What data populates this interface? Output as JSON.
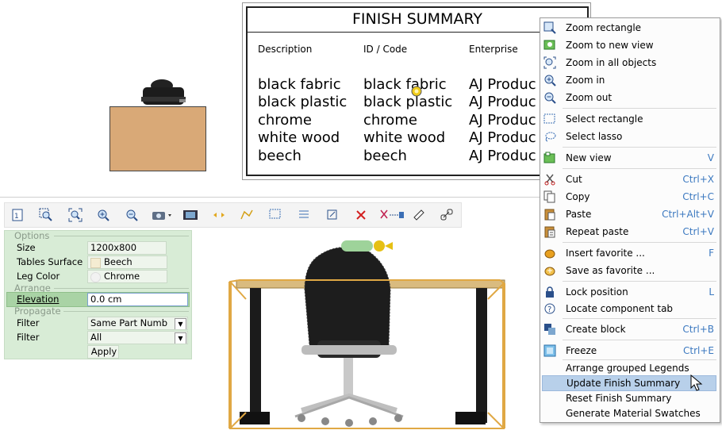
{
  "finish_summary": {
    "title": "FINISH SUMMARY",
    "headers": [
      "Description",
      "ID / Code",
      "Enterprise"
    ],
    "rows": [
      [
        "black fabric",
        "black fabric",
        "AJ Produc"
      ],
      [
        "black plastic",
        "black plastic",
        "AJ Produc"
      ],
      [
        "chrome",
        "chrome",
        "AJ Produc"
      ],
      [
        "white wood",
        "white wood",
        "AJ Produc"
      ],
      [
        "beech",
        "beech",
        "AJ Produc"
      ]
    ]
  },
  "toolbar": {
    "buttons": [
      "page-view-icon",
      "zoom-rectangle-icon",
      "zoom-all-icon",
      "zoom-in-icon",
      "zoom-out-icon",
      "camera-icon",
      "film-icon",
      "move-arrows-icon",
      "polyline-icon",
      "select-rectangle-icon",
      "list-icon",
      "transform-icon",
      "delete-icon",
      "cut-icon",
      "ruler-icon",
      "link-icon"
    ]
  },
  "options": {
    "section_options": "Options",
    "size_label": "Size",
    "size_value": "1200x800",
    "tables_surface_label": "Tables Surface",
    "tables_surface_value": "Beech",
    "leg_color_label": "Leg Color",
    "leg_color_value": "Chrome",
    "section_arrange": "Arrange",
    "elevation_label": "Elevation",
    "elevation_value": "0.0 cm",
    "section_propagate": "Propagate",
    "filter_label": "Filter",
    "filter1_value": "Same Part Numb",
    "filter2_value": "All",
    "apply_label": "Apply"
  },
  "menu": {
    "items": [
      {
        "label": "Zoom rectangle",
        "shortcut": "",
        "icon": "zoom-rectangle-icon"
      },
      {
        "label": "Zoom to new view",
        "shortcut": "",
        "icon": "zoom-new-view-icon"
      },
      {
        "label": "Zoom in all objects",
        "shortcut": "",
        "icon": "zoom-all-icon"
      },
      {
        "label": "Zoom in",
        "shortcut": "",
        "icon": "zoom-in-icon"
      },
      {
        "label": "Zoom out",
        "shortcut": "",
        "icon": "zoom-out-icon"
      },
      {
        "label": "Select rectangle",
        "shortcut": "",
        "icon": "select-rectangle-icon"
      },
      {
        "label": "Select lasso",
        "shortcut": "",
        "icon": "select-lasso-icon"
      },
      {
        "label": "New view",
        "shortcut": "V",
        "icon": "new-view-icon"
      },
      {
        "label": "Cut",
        "shortcut": "Ctrl+X",
        "icon": "scissors-icon"
      },
      {
        "label": "Copy",
        "shortcut": "Ctrl+C",
        "icon": "copy-icon"
      },
      {
        "label": "Paste",
        "shortcut": "Ctrl+Alt+V",
        "icon": "paste-icon"
      },
      {
        "label": "Repeat paste",
        "shortcut": "Ctrl+V",
        "icon": "repeat-paste-icon"
      },
      {
        "label": "Insert favorite ...",
        "shortcut": "F",
        "icon": "insert-favorite-icon"
      },
      {
        "label": "Save as favorite ...",
        "shortcut": "",
        "icon": "save-favorite-icon"
      },
      {
        "label": "Lock position",
        "shortcut": "L",
        "icon": "lock-icon"
      },
      {
        "label": "Locate component tab",
        "shortcut": "",
        "icon": "locate-icon"
      },
      {
        "label": "Create block",
        "shortcut": "Ctrl+B",
        "icon": "create-block-icon"
      },
      {
        "label": "Freeze",
        "shortcut": "Ctrl+E",
        "icon": "freeze-icon"
      },
      {
        "label": "Arrange grouped Legends",
        "shortcut": "",
        "icon": ""
      },
      {
        "label": "Update Finish Summary",
        "shortcut": "",
        "icon": ""
      },
      {
        "label": "Reset Finish Summary",
        "shortcut": "",
        "icon": ""
      },
      {
        "label": "Generate Material Swatches",
        "shortcut": "",
        "icon": ""
      }
    ],
    "highlighted_index": 19,
    "accent_color": "#3c79c0",
    "highlight_color": "#b8d0ea"
  },
  "colors": {
    "panel_bg": "#d8ecd6",
    "desk_top": "#d9a977",
    "selection_box": "#e0a844"
  }
}
